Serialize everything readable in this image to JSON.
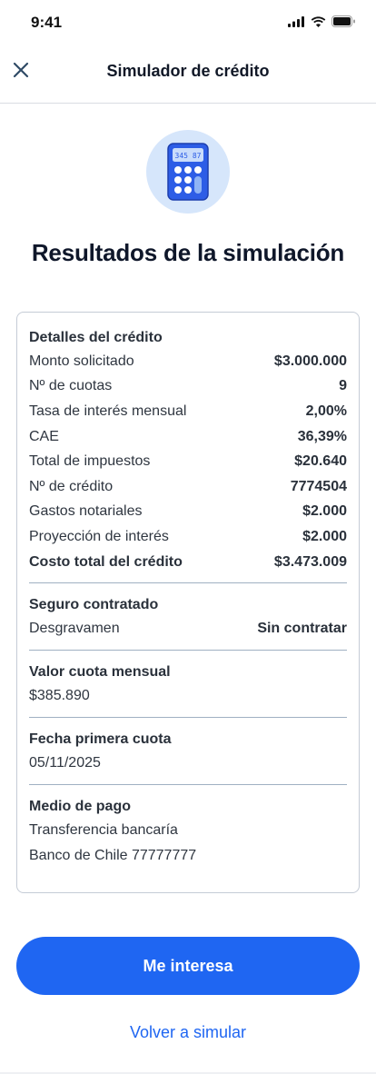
{
  "status_bar": {
    "time": "9:41"
  },
  "nav": {
    "title": "Simulador de crédito"
  },
  "hero": {
    "icon": "calculator-icon",
    "display": "345 87"
  },
  "title": "Resultados de la simulación",
  "details": {
    "title": "Detalles del crédito",
    "rows": [
      {
        "label": "Monto solicitado",
        "value": "$3.000.000"
      },
      {
        "label": "Nº de cuotas",
        "value": "9"
      },
      {
        "label": "Tasa de interés mensual",
        "value": "2,00%"
      },
      {
        "label": "CAE",
        "value": "36,39%"
      },
      {
        "label": "Total de impuestos",
        "value": "$20.640"
      },
      {
        "label": "Nº de crédito",
        "value": "7774504"
      },
      {
        "label": "Gastos notariales",
        "value": "$2.000"
      },
      {
        "label": "Proyección de interés",
        "value": "$2.000"
      },
      {
        "label": "Costo total del crédito",
        "value": "$3.473.009"
      }
    ]
  },
  "insurance": {
    "title": "Seguro contratado",
    "label": "Desgravamen",
    "value": "Sin contratar"
  },
  "installment": {
    "title": "Valor cuota mensual",
    "value": "$385.890"
  },
  "first_payment": {
    "title": "Fecha primera cuota",
    "value": "05/11/2025"
  },
  "payment_method": {
    "title": "Medio de pago",
    "line1": "Transferencia bancaría",
    "line2": "Banco de Chile 77777777"
  },
  "actions": {
    "primary": "Me interesa",
    "secondary": "Volver a simular"
  },
  "colors": {
    "accent": "#1f66f2",
    "icon_bg": "#d6e6fb"
  }
}
